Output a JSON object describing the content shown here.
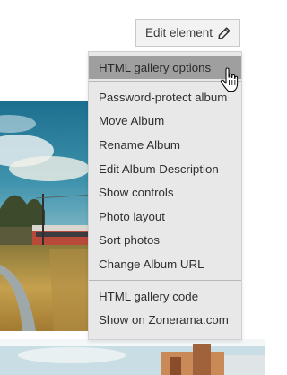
{
  "toolbar": {
    "edit_label": "Edit element"
  },
  "menu": {
    "highlighted": "HTML gallery options",
    "group1": [
      "Password-protect album",
      "Move Album",
      "Rename Album",
      "Edit Album Description",
      "Show controls",
      "Photo layout",
      "Sort photos",
      "Change Album URL"
    ],
    "group2": [
      "HTML gallery code",
      "Show on Zonerama.com"
    ]
  },
  "colors": {
    "menu_bg": "#e8e8e8",
    "menu_highlight": "#9f9f9f",
    "button_bg": "#f2f2f2"
  },
  "icons": [
    "pencil-icon",
    "hand-pointer-icon"
  ]
}
